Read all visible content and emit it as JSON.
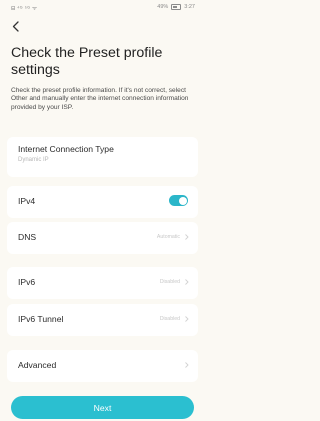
{
  "status_bar": {
    "left": "ᗺ ⁴ᴳ ⁵ᴳ ᯤ",
    "battery": "49%",
    "time": "3:27"
  },
  "icons": {
    "back": "chevron-left-icon",
    "chevron": "chevron-right-icon"
  },
  "header": {
    "title": "Check the Preset profile settings",
    "description": "Check the preset profile information. If it's not correct, select Other and manually enter the internet connection information provided by your ISP."
  },
  "connection": {
    "label": "Internet Connection Type",
    "value": "Dynamic IP"
  },
  "rows": {
    "ipv4": {
      "label": "IPv4",
      "enabled": true
    },
    "dns": {
      "label": "DNS",
      "value": "Automatic"
    },
    "ipv6": {
      "label": "IPv6",
      "value": "Disabled"
    },
    "ipv6_tunnel": {
      "label": "IPv6 Tunnel",
      "value": "Disabled"
    },
    "advanced": {
      "label": "Advanced"
    }
  },
  "actions": {
    "next": "Next"
  },
  "colors": {
    "accent": "#2bbfd0",
    "background": "#fbf9f3"
  }
}
